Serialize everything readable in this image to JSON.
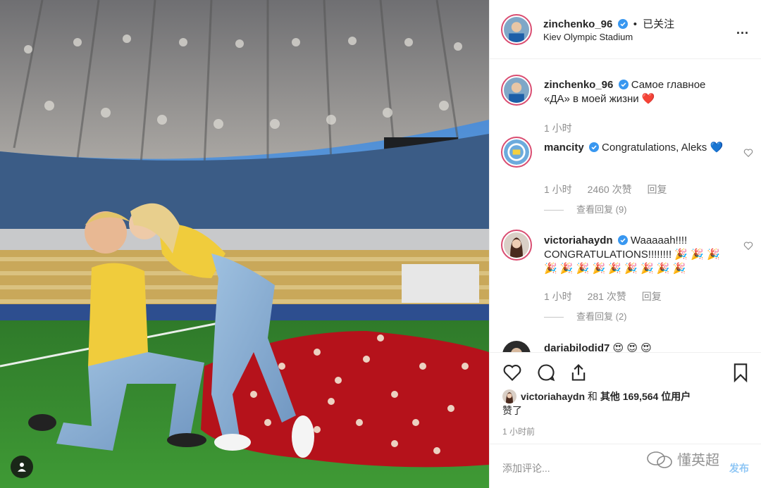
{
  "header": {
    "username": "zinchenko_96",
    "dot": "•",
    "follow_status": "已关注",
    "location": "Kiev Olympic Stadium",
    "more": "..."
  },
  "caption": {
    "username": "zinchenko_96",
    "text": "Самое главное «ДА» в моей жизни ❤️",
    "time": "1 小时"
  },
  "comments": [
    {
      "username": "mancity",
      "text": "Congratulations, Aleks 💙",
      "time": "1 小时",
      "likes": "2460 次赞",
      "reply": "回复",
      "view_replies": "查看回复 (9)"
    },
    {
      "username": "victoriahaydn",
      "text": "Waaaaah!!!! CONGRATULATIONS!!!!!!!! 🎉 🎉 🎉 🎉 🎉 🎉 🎉 🎉 🎉 🎉 🎉 🎉",
      "time": "1 小时",
      "likes": "281 次赞",
      "reply": "回复",
      "view_replies": "查看回复 (2)"
    },
    {
      "username": "dariabilodid7",
      "text": "😍 😍 😍"
    }
  ],
  "likes": {
    "user": "victoriahaydn",
    "connector": "和",
    "others": "其他 169,564 位用户",
    "suffix": "赞了"
  },
  "post_time": "1 小时前",
  "add_comment": {
    "placeholder": "添加评论...",
    "post_label": "发布"
  },
  "watermark": "懂英超",
  "icons": {
    "verified": "verified-badge-icon",
    "heart": "heart-icon",
    "comment": "comment-icon",
    "share": "share-icon",
    "save": "bookmark-icon",
    "tag": "user-tag-icon"
  },
  "colors": {
    "verified_blue": "#3897f0",
    "story_ring": "#d94d71",
    "muted_text": "#8e8e8e",
    "post_disabled": "#8ec6f5"
  }
}
